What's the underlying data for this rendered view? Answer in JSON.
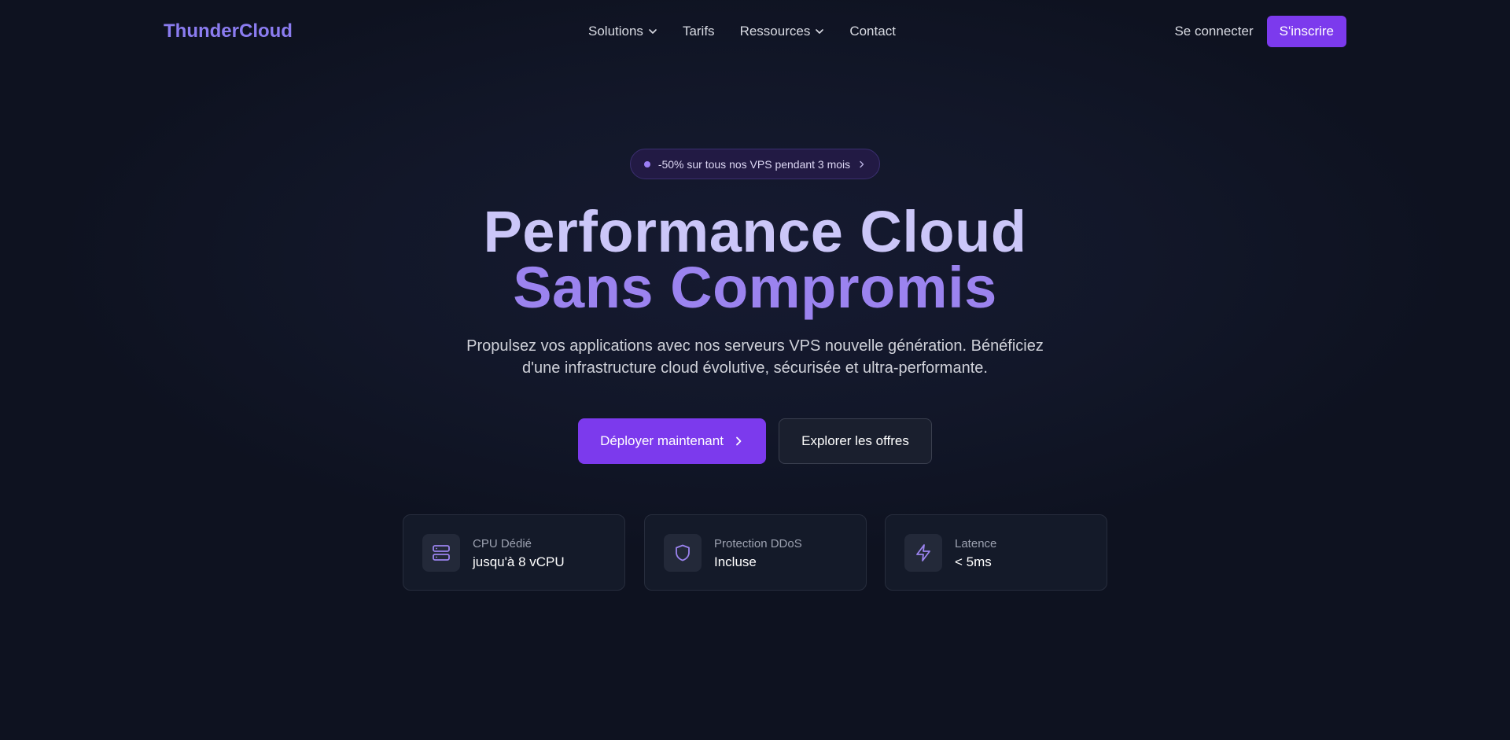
{
  "brand": {
    "name": "ThunderCloud"
  },
  "nav": {
    "items": [
      {
        "label": "Solutions",
        "dropdown": true
      },
      {
        "label": "Tarifs",
        "dropdown": false
      },
      {
        "label": "Ressources",
        "dropdown": true
      },
      {
        "label": "Contact",
        "dropdown": false
      }
    ],
    "login_label": "Se connecter",
    "signup_label": "S'inscrire"
  },
  "promo": {
    "text": "-50% sur tous nos VPS pendant 3 mois"
  },
  "hero": {
    "title_line1": "Performance Cloud",
    "title_line2": "Sans Compromis",
    "subtitle": "Propulsez vos applications avec nos serveurs VPS nouvelle génération. Bénéficiez d'une infrastructure cloud évolutive, sécurisée et ultra-performante."
  },
  "cta": {
    "primary_label": "Déployer maintenant",
    "secondary_label": "Explorer les offres"
  },
  "features": [
    {
      "icon": "server-icon",
      "label": "CPU Dédié",
      "value": "jusqu'à 8 vCPU"
    },
    {
      "icon": "shield-icon",
      "label": "Protection DDoS",
      "value": "Incluse"
    },
    {
      "icon": "lightning-icon",
      "label": "Latence",
      "value": "< 5ms"
    }
  ],
  "colors": {
    "accent": "#7c3aed",
    "brand": "#8b7cf0",
    "title_light": "#cbc6f8",
    "title_accent": "#9b83ef",
    "background": "#111626"
  }
}
